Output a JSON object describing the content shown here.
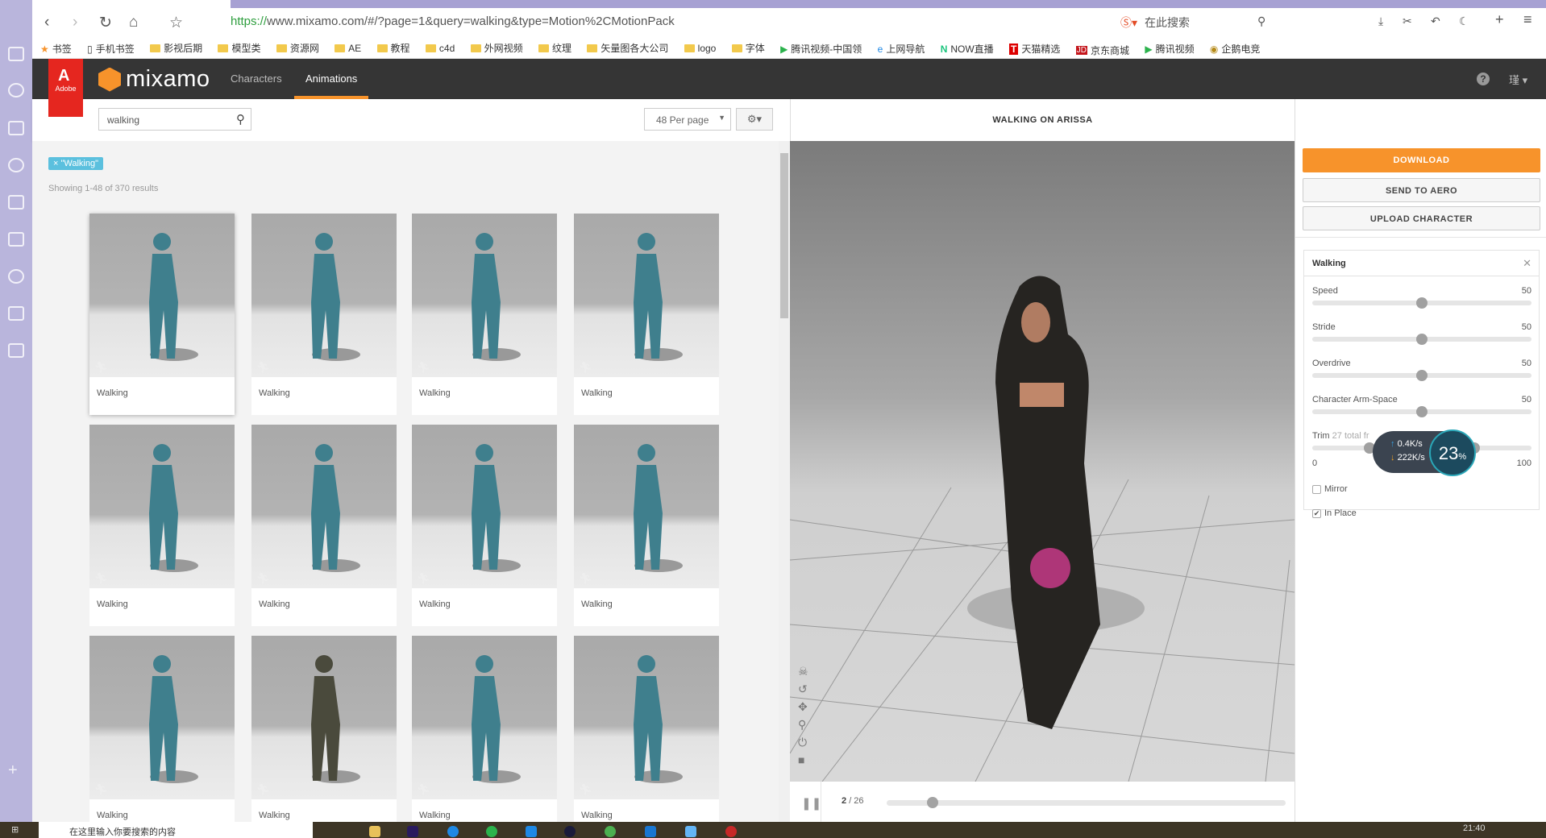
{
  "browser": {
    "url_scheme": "https://",
    "url_rest": "www.mixamo.com/#/?page=1&query=walking&type=Motion%2CMotionPack",
    "search_engine_label": "在此搜索",
    "bookmarks": [
      "书签",
      "手机书签",
      "影视后期",
      "模型类",
      "资源网",
      "AE",
      "教程",
      "c4d",
      "外网视频",
      "纹理",
      "矢量图各大公司",
      "logo",
      "字体",
      "腾讯视频-中国领",
      "上网导航",
      "NOW直播",
      "天猫精选",
      "京东商城",
      "腾讯视频",
      "企鹅电竞"
    ]
  },
  "header": {
    "brand": "mixamo",
    "adobe": "Adobe",
    "tabs": [
      "Characters",
      "Animations"
    ],
    "active_tab": "Animations",
    "help": "?",
    "user": "瑾"
  },
  "toolbar": {
    "search_value": "walking",
    "per_page": "48 Per page"
  },
  "results": {
    "filter_chip": "× \"Walking\"",
    "count_text": "Showing 1-48 of 370 results",
    "cards": [
      "Walking",
      "Walking",
      "Walking",
      "Walking",
      "Walking",
      "Walking",
      "Walking",
      "Walking",
      "Walking",
      "Walking",
      "Walking",
      "Walking"
    ]
  },
  "viewer": {
    "title": "WALKING ON ARISSA",
    "frame_current": "2",
    "frame_total": "/ 26",
    "frame_progress": 0.04
  },
  "sidebar": {
    "download": "DOWNLOAD",
    "send": "SEND TO AERO",
    "upload": "UPLOAD CHARACTER",
    "panel_title": "Walking",
    "params": [
      {
        "label": "Speed",
        "value": "50"
      },
      {
        "label": "Stride",
        "value": "50"
      },
      {
        "label": "Overdrive",
        "value": "50"
      },
      {
        "label": "Character Arm-Space",
        "value": "50"
      }
    ],
    "trim": {
      "label": "Trim",
      "hint": "27 total fr",
      "min": "0",
      "max": "100"
    },
    "mirror": "Mirror",
    "mirror_checked": false,
    "in_place": "In Place",
    "in_place_checked": true
  },
  "overlay": {
    "up": "0.4K/s",
    "down": "222K/s",
    "percent": "23",
    "pct_sign": "%"
  },
  "taskbar": {
    "search_placeholder": "在这里输入你要搜索的内容",
    "clock": "21:40"
  },
  "colors": {
    "accent": "#f7932b",
    "header": "#353535",
    "adobe": "#e5261f",
    "chip": "#5bc0de"
  }
}
